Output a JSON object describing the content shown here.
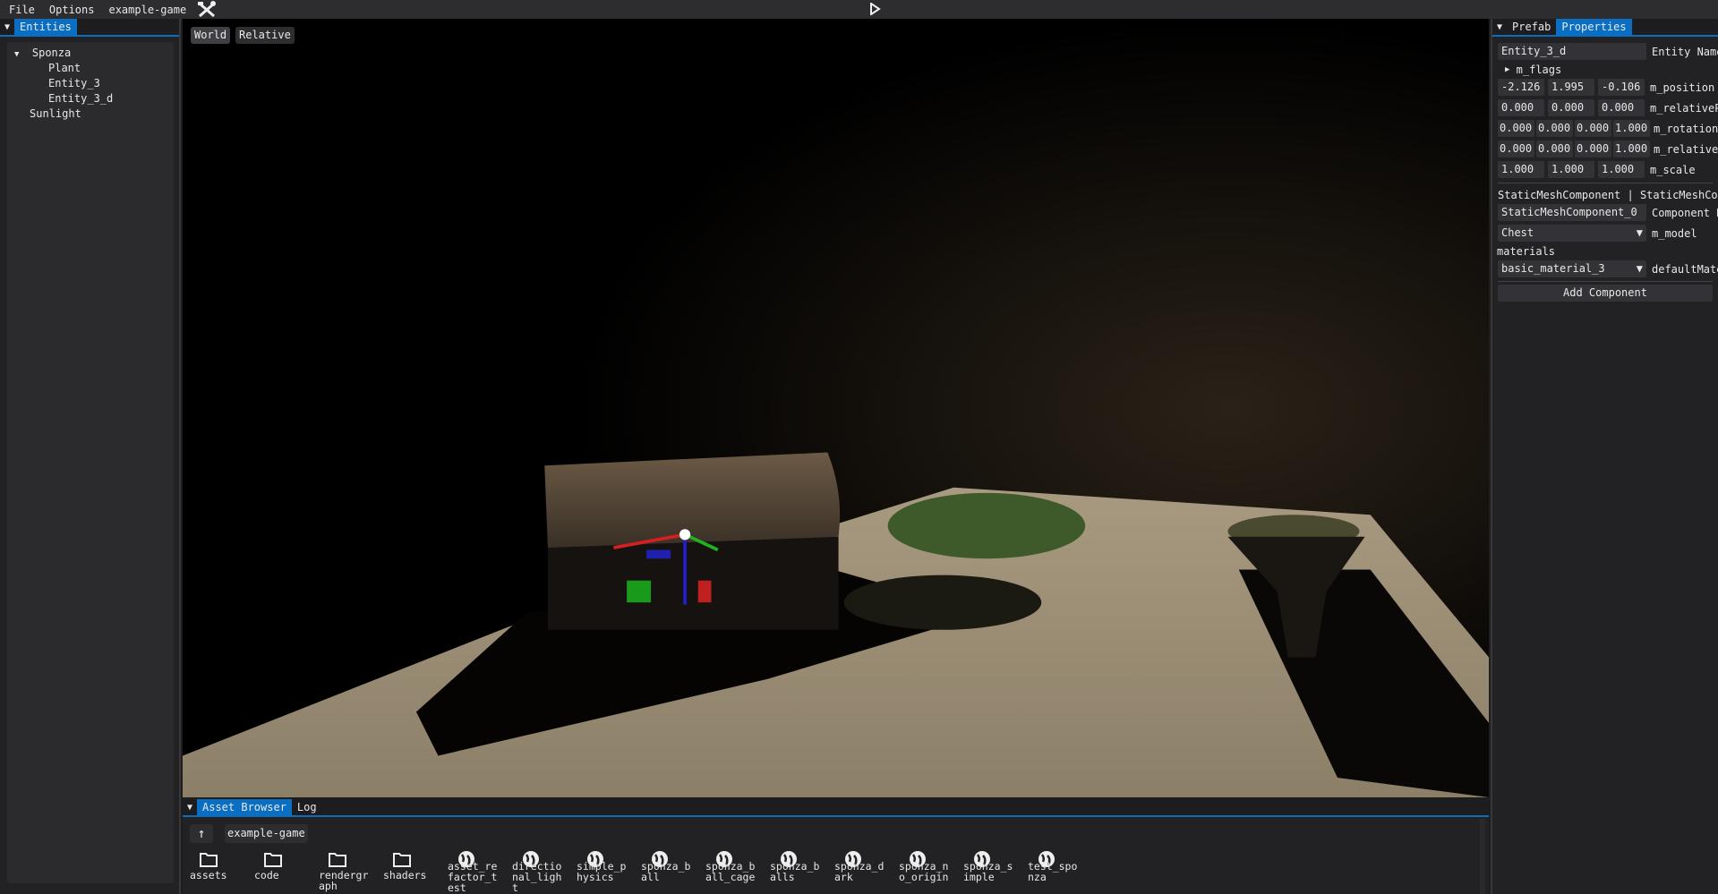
{
  "menu": {
    "items": [
      "File",
      "Options",
      "example-game"
    ]
  },
  "entities_panel": {
    "tab": "Entities",
    "tree": [
      {
        "label": "Sponza",
        "expanded": true,
        "depth": 0
      },
      {
        "label": "Plant",
        "depth": 1
      },
      {
        "label": "Entity_3",
        "depth": 1
      },
      {
        "label": "Entity_3_d",
        "depth": 1
      },
      {
        "label": "Sunlight",
        "depth": 0
      }
    ]
  },
  "viewport": {
    "world_label": "World",
    "relative_label": "Relative"
  },
  "properties_panel": {
    "tabs": [
      "Prefab",
      "Properties"
    ],
    "active_tab": "Properties",
    "entity_name": "Entity_3_d",
    "entity_name_label": "Entity Name",
    "flags_label": "m_flags",
    "position": [
      "-2.126",
      "1.995",
      "-0.106"
    ],
    "position_label": "m_position",
    "relative_position": [
      "0.000",
      "0.000",
      "0.000"
    ],
    "relative_position_label": "m_relativePosition",
    "rotation": [
      "0.000",
      "0.000",
      "0.000",
      "1.000"
    ],
    "rotation_label": "m_rotation",
    "relative_rotation": [
      "0.000",
      "0.000",
      "0.000",
      "1.000"
    ],
    "relative_rotation_label": "m_relativeRotation",
    "scale": [
      "1.000",
      "1.000",
      "1.000"
    ],
    "scale_label": "m_scale",
    "component_header": "StaticMeshComponent | StaticMeshComponent",
    "component_name": "StaticMeshComponent_0",
    "component_name_label": "Component Name",
    "model": "Chest",
    "model_label": "m_model",
    "materials_label": "materials",
    "material": "basic_material_3",
    "material_label": "defaultMaterial",
    "add_component": "Add Component"
  },
  "bottom_panel": {
    "tabs": [
      "Asset Browser",
      "Log"
    ],
    "active_tab": "Asset Browser",
    "path": "example-game",
    "assets": [
      {
        "name": "assets",
        "type": "folder"
      },
      {
        "name": "code",
        "type": "folder"
      },
      {
        "name": "rendergraph",
        "type": "folder"
      },
      {
        "name": "shaders",
        "type": "folder"
      },
      {
        "name": "asset_refactor_test",
        "type": "scene"
      },
      {
        "name": "directional_light",
        "type": "scene"
      },
      {
        "name": "simple_physics",
        "type": "scene"
      },
      {
        "name": "sponza_ball",
        "type": "scene"
      },
      {
        "name": "sponza_ball_cage",
        "type": "scene"
      },
      {
        "name": "sponza_balls",
        "type": "scene"
      },
      {
        "name": "sponza_dark",
        "type": "scene"
      },
      {
        "name": "sponza_no_origin",
        "type": "scene"
      },
      {
        "name": "sponza_simple",
        "type": "scene"
      },
      {
        "name": "test_sponza",
        "type": "scene"
      }
    ]
  },
  "colors": {
    "accent": "#0a6fc2",
    "gizmo_x": "#d42020",
    "gizmo_y": "#20b020",
    "gizmo_z": "#2020d0"
  }
}
